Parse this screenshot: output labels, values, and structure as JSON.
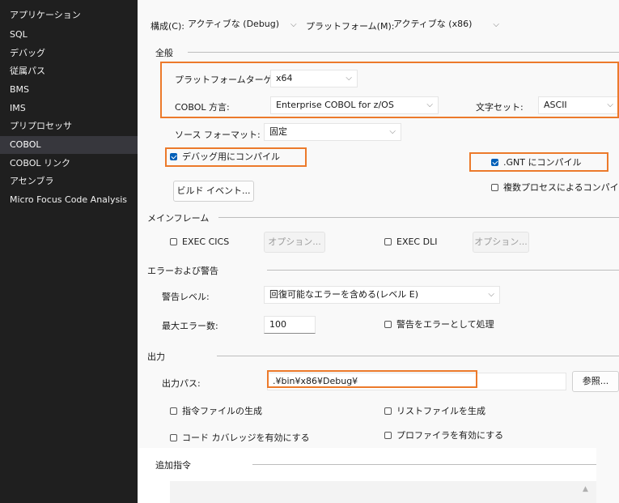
{
  "sidebar": {
    "items": [
      {
        "label": "アプリケーション"
      },
      {
        "label": "SQL"
      },
      {
        "label": "デバッグ"
      },
      {
        "label": "従属パス"
      },
      {
        "label": "BMS"
      },
      {
        "label": "IMS"
      },
      {
        "label": "プリプロセッサ"
      },
      {
        "label": "COBOL"
      },
      {
        "label": "COBOL リンク"
      },
      {
        "label": "アセンブラ"
      },
      {
        "label": "Micro Focus Code Analysis"
      }
    ],
    "selected": "COBOL"
  },
  "top": {
    "config_label": "構成(C):",
    "config_value": "アクティブな (Debug)",
    "platform_label": "プラットフォーム(M):",
    "platform_value": "アクティブな (x86)"
  },
  "general": {
    "heading": "全般",
    "platform_target_label": "プラットフォームターゲット:",
    "platform_target_value": "x64",
    "dialect_label": "COBOL 方言:",
    "dialect_value": "Enterprise COBOL for z/OS",
    "charset_label": "文字セット:",
    "charset_value": "ASCII",
    "source_format_label": "ソース フォーマット:",
    "source_format_value": "固定",
    "debug_compile_label": "デバッグ用にコンパイル",
    "debug_compile_checked": true,
    "gnt_compile_label": ".GNT にコンパイル",
    "gnt_compile_checked": true,
    "multi_process_label": "複数プロセスによるコンパイル",
    "multi_process_checked": false,
    "build_events_label": "ビルド イベント..."
  },
  "mainframe": {
    "heading": "メインフレーム",
    "exec_cics_label": "EXEC CICS",
    "exec_cics_options": "オプション...",
    "exec_dli_label": "EXEC DLI",
    "exec_dli_options": "オプション..."
  },
  "errors": {
    "heading": "エラーおよび警告",
    "warning_level_label": "警告レベル:",
    "warning_level_value": "回復可能なエラーを含める(レベル E)",
    "max_errors_label": "最大エラー数:",
    "max_errors_value": "100",
    "warnings_as_errors_label": "警告をエラーとして処理"
  },
  "output": {
    "heading": "出力",
    "path_label": "出力パス:",
    "path_value": ".¥bin¥x86¥Debug¥",
    "browse_label": "参照...",
    "directive_file_label": "指令ファイルの生成",
    "list_file_label": "リストファイルを生成",
    "coverage_label": "コード カバレッジを有効にする",
    "profiler_label": "プロファイラを有効にする"
  },
  "additional": {
    "heading": "追加指令"
  },
  "colors": {
    "highlight": "#ec7a2b",
    "sidebar_bg": "#1f1f1f",
    "selected_bg": "#37373d",
    "check": "#005fb8"
  }
}
